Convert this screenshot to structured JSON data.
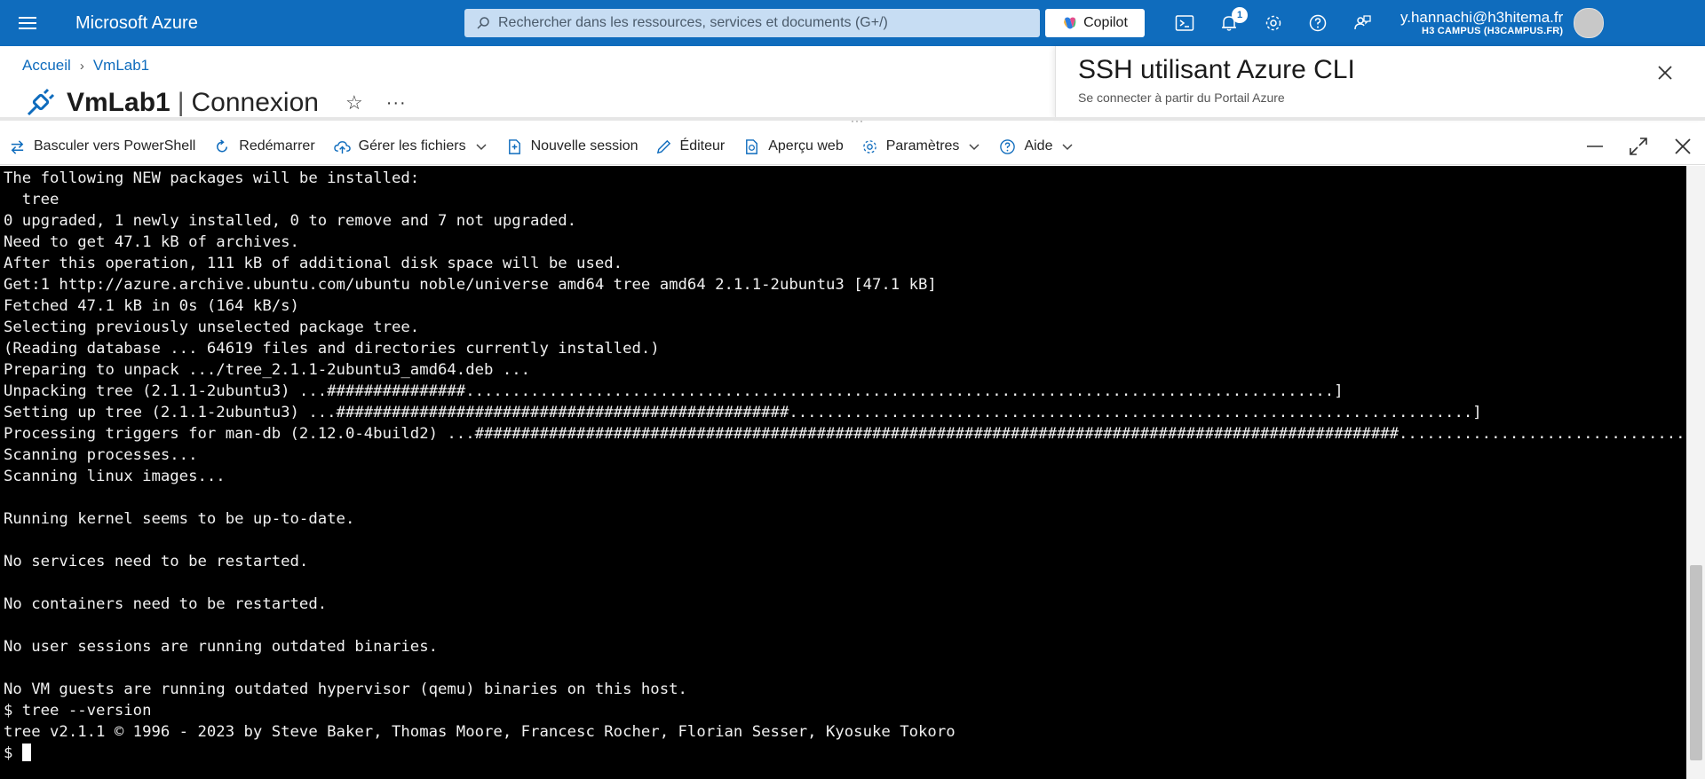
{
  "topbar": {
    "brand": "Microsoft Azure",
    "search_placeholder": "Rechercher dans les ressources, services et documents (G+/)",
    "copilot_label": "Copilot",
    "notifications_count": "1",
    "account_email": "y.hannachi@h3hitema.fr",
    "account_tenant": "H3 CAMPUS (H3CAMPUS.FR)"
  },
  "breadcrumb": [
    "Accueil",
    "VmLab1"
  ],
  "page": {
    "resource_name": "VmLab1",
    "subpage": "Connexion",
    "more_label": "···"
  },
  "sidepanel": {
    "title": "SSH utilisant Azure CLI",
    "subtitle": "Se connecter à partir du Portail Azure"
  },
  "shell_toolbar": {
    "switch_label": "Basculer vers PowerShell",
    "restart_label": "Redémarrer",
    "files_label": "Gérer les fichiers",
    "new_session_label": "Nouvelle session",
    "editor_label": "Éditeur",
    "web_preview_label": "Aperçu web",
    "settings_label": "Paramètres",
    "help_label": "Aide"
  },
  "terminal": {
    "lines": [
      "The following NEW packages will be installed:",
      "  tree",
      "0 upgraded, 1 newly installed, 0 to remove and 7 not upgraded.",
      "Need to get 47.1 kB of archives.",
      "After this operation, 111 kB of additional disk space will be used.",
      "Get:1 http://azure.archive.ubuntu.com/ubuntu noble/universe amd64 tree amd64 2.1.1-2ubuntu3 [47.1 kB]",
      "Fetched 47.1 kB in 0s (164 kB/s)",
      "Selecting previously unselected package tree.",
      "(Reading database ... 64619 files and directories currently installed.)",
      "Preparing to unpack .../tree_2.1.1-2ubuntu3_amd64.deb ...",
      "Unpacking tree (2.1.1-2ubuntu3) ...###############..............................................................................................]",
      "Setting up tree (2.1.1-2ubuntu3) ...#################################################..........................................................................]",
      "Processing triggers for man-db (2.12.0-4build2) ...####################################################################################################...................................]",
      "Scanning processes...",
      "Scanning linux images...",
      "",
      "Running kernel seems to be up-to-date.",
      "",
      "No services need to be restarted.",
      "",
      "No containers need to be restarted.",
      "",
      "No user sessions are running outdated binaries.",
      "",
      "No VM guests are running outdated hypervisor (qemu) binaries on this host.",
      "$ tree --version",
      "tree v2.1.1 © 1996 - 2023 by Steve Baker, Thomas Moore, Francesc Rocher, Florian Sesser, Kyosuke Tokoro"
    ],
    "prompt": "$ "
  },
  "colors": {
    "azure_blue": "#0f6cbd",
    "terminal_bg": "#000000",
    "terminal_fg": "#f0f0f0"
  }
}
